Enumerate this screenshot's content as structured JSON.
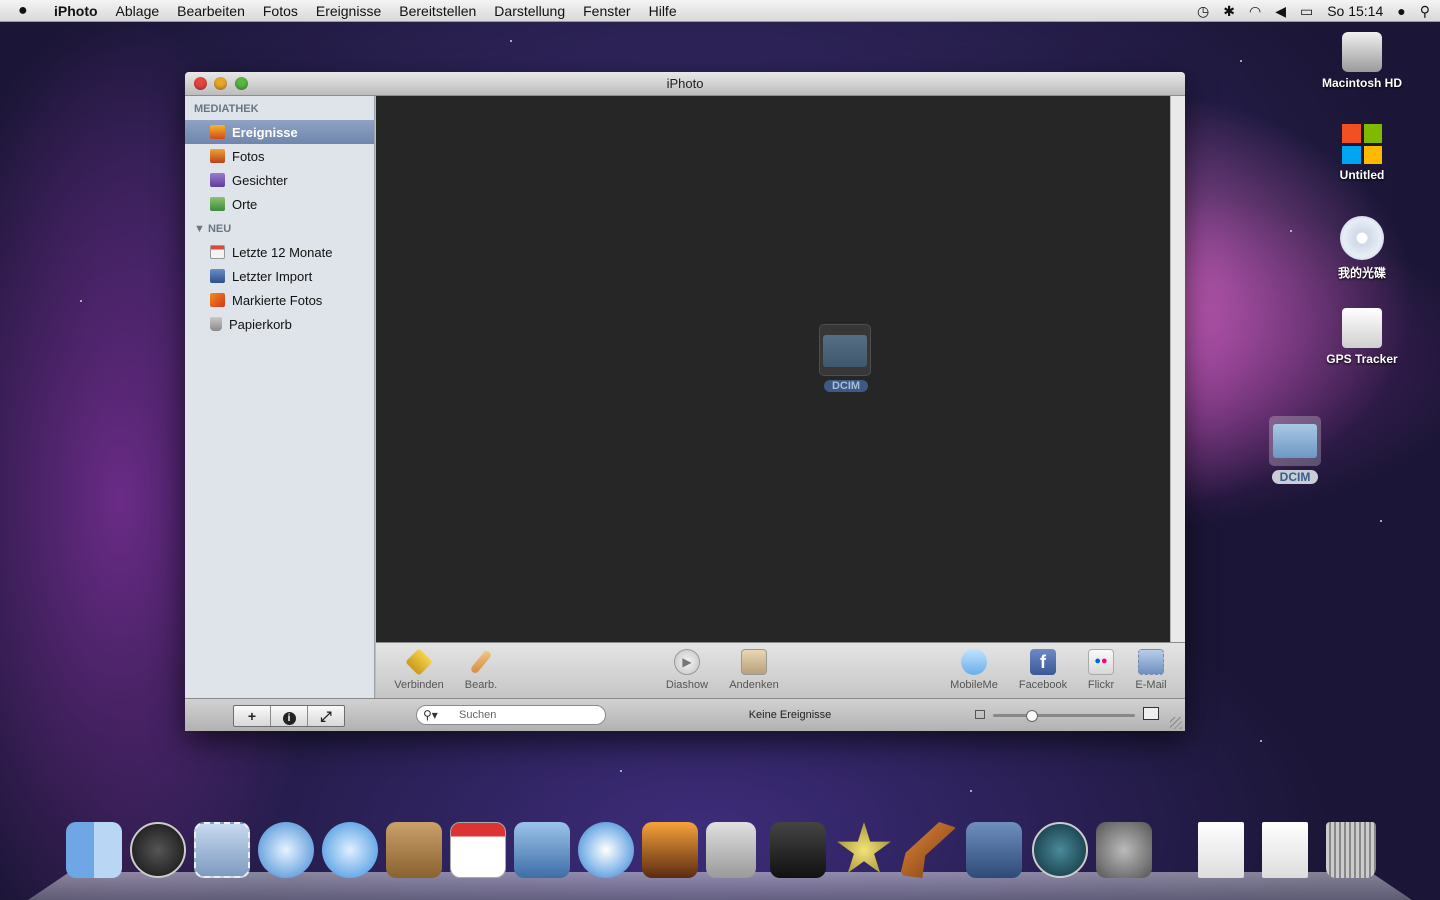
{
  "menubar": {
    "apple": "",
    "items": [
      "iPhoto",
      "Ablage",
      "Bearbeiten",
      "Fotos",
      "Ereignisse",
      "Bereitstellen",
      "Darstellung",
      "Fenster",
      "Hilfe"
    ],
    "clock": "So 15:14"
  },
  "window": {
    "title": "iPhoto",
    "sidebar": {
      "section1": "MEDIATHEK",
      "library": [
        {
          "label": "Ereignisse",
          "icon": "events-icon",
          "selected": true
        },
        {
          "label": "Fotos",
          "icon": "photos-icon"
        },
        {
          "label": "Gesichter",
          "icon": "faces-icon"
        },
        {
          "label": "Orte",
          "icon": "places-icon"
        }
      ],
      "section2": "NEU",
      "recent": [
        {
          "label": "Letzte 12 Monate",
          "icon": "calendar-icon"
        },
        {
          "label": "Letzter Import",
          "icon": "import-icon"
        },
        {
          "label": "Markierte Fotos",
          "icon": "flag-icon"
        },
        {
          "label": "Papierkorb",
          "icon": "trash-icon"
        }
      ]
    },
    "content": {
      "drag_item_label": "DCIM"
    },
    "toolbar": {
      "left": [
        "Verbinden",
        "Bearb."
      ],
      "center": [
        "Diashow",
        "Andenken"
      ],
      "right": [
        "MobileMe",
        "Facebook",
        "Flickr",
        "E-Mail"
      ]
    },
    "bottombar": {
      "add": "+",
      "info": "i",
      "fullscreen": "⤢",
      "search_placeholder": "Suchen",
      "status": "Keine Ereignisse",
      "zoom_level": 0.25
    }
  },
  "desktop": {
    "icons": [
      "Macintosh HD",
      "Untitled",
      "我的光碟",
      "GPS Tracker",
      "DCIM"
    ]
  },
  "colors": {
    "selection": "#7b90b6",
    "content_bg": "#262626",
    "sidebar_bg": "#dee4ea"
  }
}
